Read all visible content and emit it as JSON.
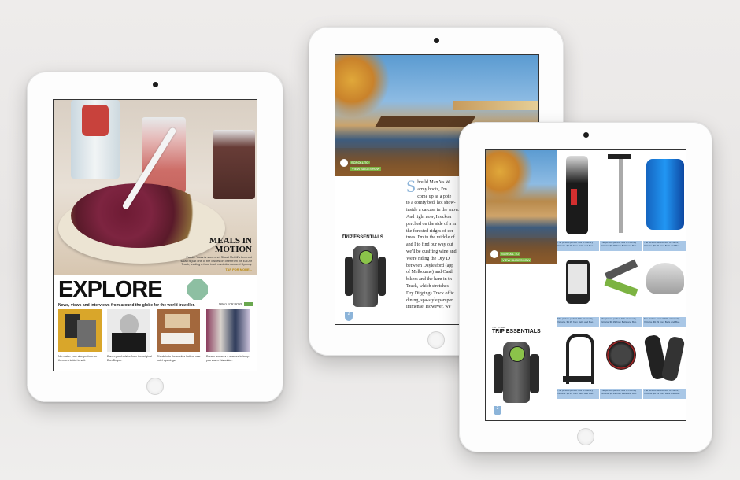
{
  "tablet1": {
    "meals": {
      "title_line1": "MEALS IN",
      "title_line2": "MOTION",
      "body": "Foodie Yoann's sous chef Stuart McGill's beetroot salad is just one of the dishes on offer from his Eat Air Truck, leading a food truck revolution around Sydney.",
      "tap": "TAP FOR MORE..."
    },
    "explore": {
      "title": "EXPLORE",
      "subtitle": "News, views and interviews from around the globe for the world traveller.",
      "drag": "DRAG FOR MORE"
    },
    "captions": [
      "No matter your size preference there's a tablet to suit.",
      "Damn good advice from the original Don Draper.",
      "Check in to the world's hottest new hotel openings.",
      "Dream weavers – scarves to keep you warm this winter."
    ]
  },
  "tablet2": {
    "scroll_label_1": "SCROLL TO",
    "scroll_label_2": "VIEW SLIDESHOW",
    "tap_label": "TAP TO SEE",
    "trip_essentials": "TRIP ESSENTIALS",
    "page_num": "2",
    "article": {
      "dropcap": "S",
      "lines": [
        "hould Man Vs W",
        "army boots, I'm",
        "come up as a pote",
        "to a comfy bed, hot show-",
        "inside a carcass in the snow.",
        "And right now, I reckon",
        "perched on the side of a m",
        "the forested ridges of cer",
        "trees. I'm in the middle of",
        "and I to find our way out",
        "we'll be quaffing wine and",
        "We're riding the Dry D",
        "between Daylesford (app",
        "of Melbourne) and Castl",
        "bikers and the ham in th",
        "Track, which stretches",
        "Dry Diggings Track offic",
        "dining, spa-style pamper",
        "immense. However, we'"
      ]
    }
  },
  "tablet3": {
    "scroll_label_1": "SCROLL TO",
    "scroll_label_2": "VIEW SLIDESHOW",
    "tap_label": "TAP TO SEE",
    "trip_essentials": "TRIP ESSENTIALS",
    "page_num": "2",
    "product_caption": "The picture-perfect hills of country Victoria. $9.99 from Bells and Boo"
  },
  "colors": {
    "accent_green": "#7cb342",
    "accent_blue": "#8cb4d9",
    "caption_bg": "#a9c7e6"
  }
}
